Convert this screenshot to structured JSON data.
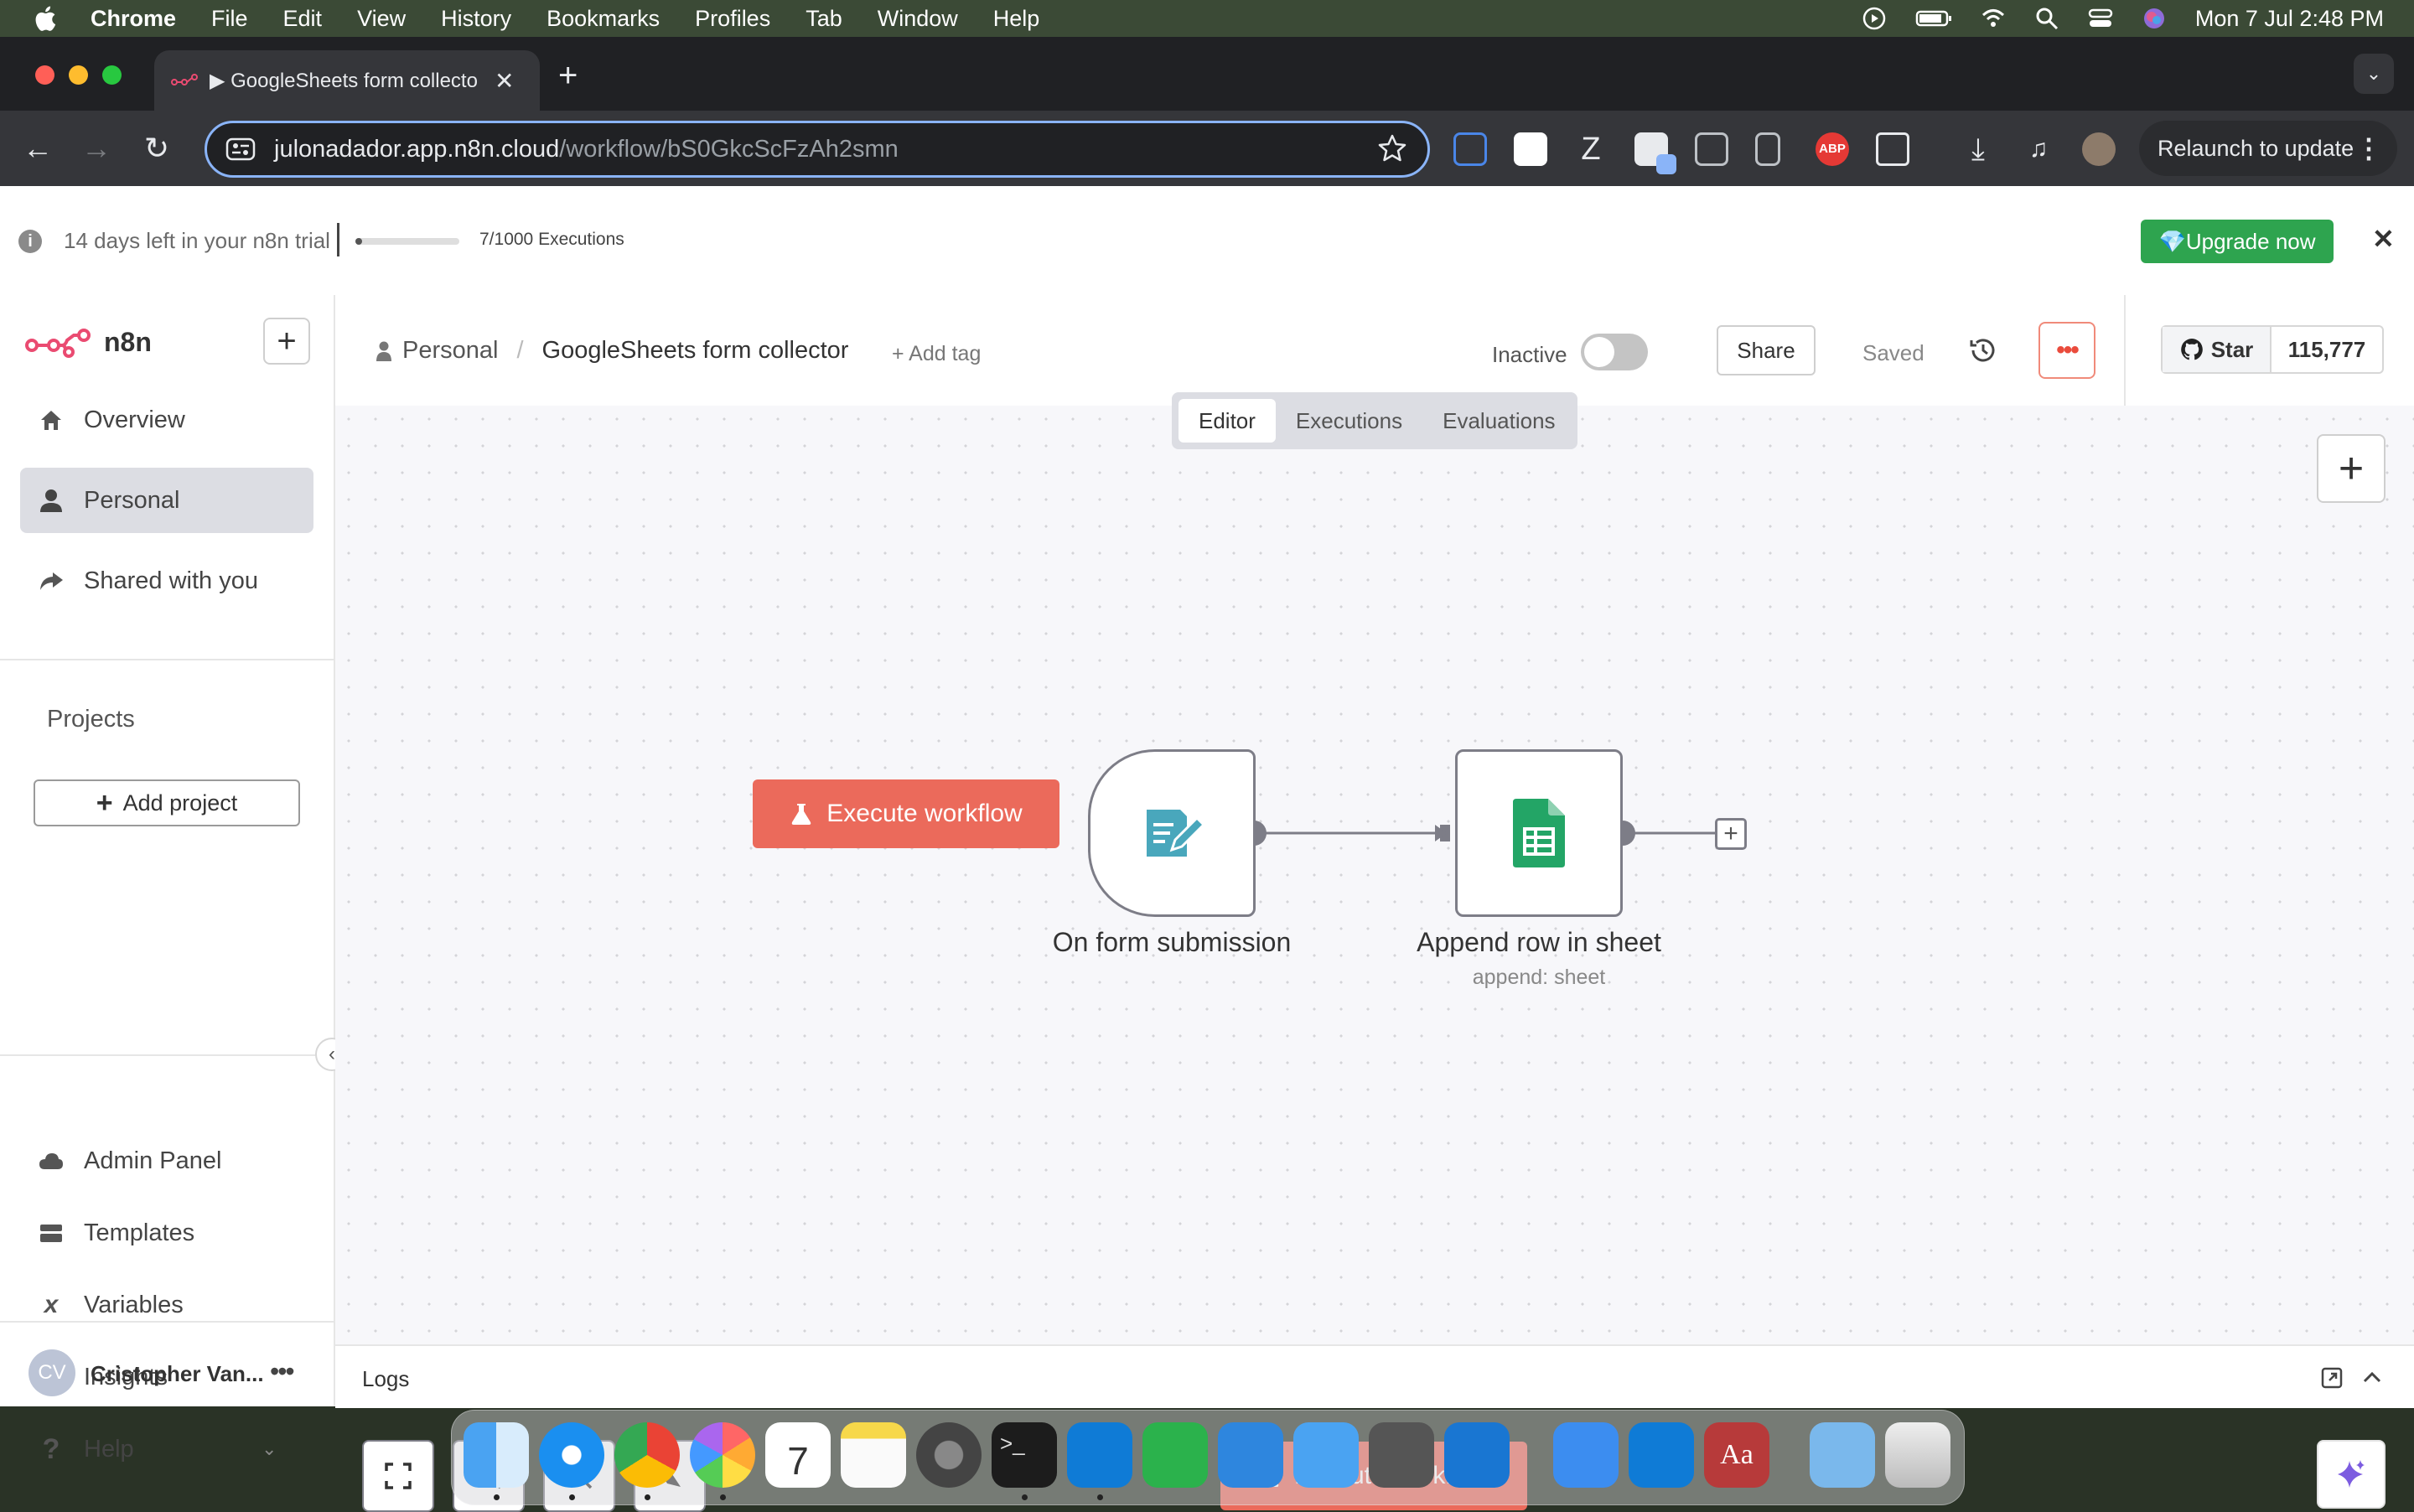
{
  "menubar": {
    "app": "Chrome",
    "items": [
      "File",
      "Edit",
      "View",
      "History",
      "Bookmarks",
      "Profiles",
      "Tab",
      "Window",
      "Help"
    ],
    "clock": "Mon 7 Jul  2:48 PM"
  },
  "browser": {
    "tab_title": "▶ GoogleSheets form collecto",
    "url_host": "julonadador.app.n8n.cloud",
    "url_path": "/workflow/bS0GkcScFzAh2smn",
    "relaunch_label": "Relaunch to update",
    "extensions": [
      "screen-capture",
      "notion",
      "zotero",
      "ext-badge",
      "window",
      "extension",
      "adblock-plus",
      "puzzle"
    ]
  },
  "trial": {
    "text": "14 days left in your n8n trial",
    "executions": "7/1000 Executions",
    "progress": 0.007,
    "upgrade_label": "💎Upgrade now"
  },
  "sidebar": {
    "logo": "n8n",
    "nav": [
      {
        "label": "Overview",
        "icon": "home-icon"
      },
      {
        "label": "Personal",
        "icon": "user-icon"
      },
      {
        "label": "Shared with you",
        "icon": "share-icon"
      }
    ],
    "projects_title": "Projects",
    "add_project": "Add project",
    "bottom": [
      {
        "label": "Admin Panel",
        "icon": "cloud-icon"
      },
      {
        "label": "Templates",
        "icon": "templates-icon"
      },
      {
        "label": "Variables",
        "icon": "variables-icon"
      },
      {
        "label": "Insights",
        "icon": "insights-icon"
      },
      {
        "label": "Help",
        "icon": "help-icon"
      }
    ],
    "user_initials": "CV",
    "user_name": "Cristopher Van..."
  },
  "header": {
    "project": "Personal",
    "workflow_name": "GoogleSheets form collector",
    "add_tag": "+ Add tag",
    "status": "Inactive",
    "active": false,
    "share": "Share",
    "saved": "Saved",
    "github_star": "Star",
    "github_count": "115,777"
  },
  "view_tabs": [
    "Editor",
    "Executions",
    "Evaluations"
  ],
  "canvas": {
    "execute_label": "Execute workflow",
    "nodes": [
      {
        "label": "On form submission",
        "sub": "",
        "icon": "form-icon"
      },
      {
        "label": "Append row in sheet",
        "sub": "append: sheet",
        "icon": "google-sheets-icon"
      }
    ]
  },
  "logs_label": "Logs",
  "colors": {
    "accent": "#eb6a5b",
    "upgrade": "#2ea44f",
    "active_nav": "#dcdde3"
  }
}
